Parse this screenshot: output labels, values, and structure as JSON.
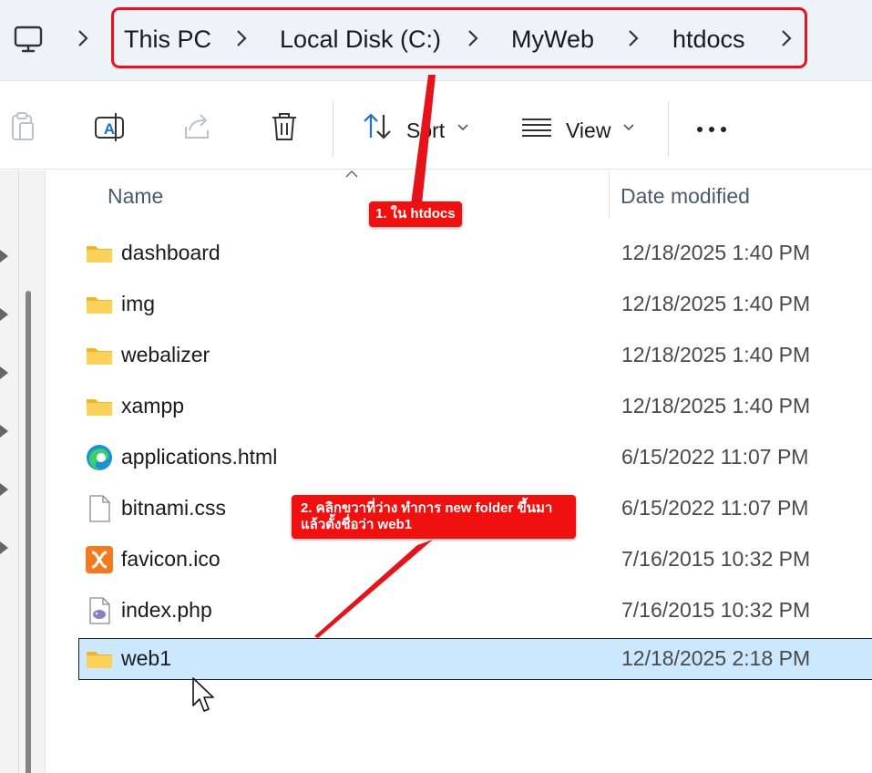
{
  "address_bar": {
    "crumbs": [
      "This PC",
      "Local Disk (C:)",
      "MyWeb",
      "htdocs"
    ]
  },
  "toolbar": {
    "sort_label": "Sort",
    "view_label": "View"
  },
  "columns": {
    "name": "Name",
    "date_modified": "Date modified"
  },
  "files": [
    {
      "name": "dashboard",
      "date": "12/18/2025 1:40 PM",
      "icon": "folder-icon"
    },
    {
      "name": "img",
      "date": "12/18/2025 1:40 PM",
      "icon": "folder-icon"
    },
    {
      "name": "webalizer",
      "date": "12/18/2025 1:40 PM",
      "icon": "folder-icon"
    },
    {
      "name": "xampp",
      "date": "12/18/2025 1:40 PM",
      "icon": "folder-icon"
    },
    {
      "name": "applications.html",
      "date": "6/15/2022 11:07 PM",
      "icon": "edge-html-icon"
    },
    {
      "name": "bitnami.css",
      "date": "6/15/2022 11:07 PM",
      "icon": "blank-file-icon"
    },
    {
      "name": "favicon.ico",
      "date": "7/16/2015 10:32 PM",
      "icon": "xampp-ico-icon"
    },
    {
      "name": "index.php",
      "date": "7/16/2015 10:32 PM",
      "icon": "php-file-icon"
    },
    {
      "name": "web1",
      "date": "12/18/2025 2:18 PM",
      "icon": "folder-icon",
      "selected": true
    }
  ],
  "annotations": {
    "callout_1": "1. ใน htdocs",
    "callout_2_line1": "2. คลิกขวาที่ว่าง ทำการ new folder ขึ้นมา",
    "callout_2_line2": "แล้วตั้งชื่อว่า web1"
  },
  "colors": {
    "highlight": "#e5141c",
    "selection": "#cce8ff",
    "folder": "#f8c93e"
  }
}
